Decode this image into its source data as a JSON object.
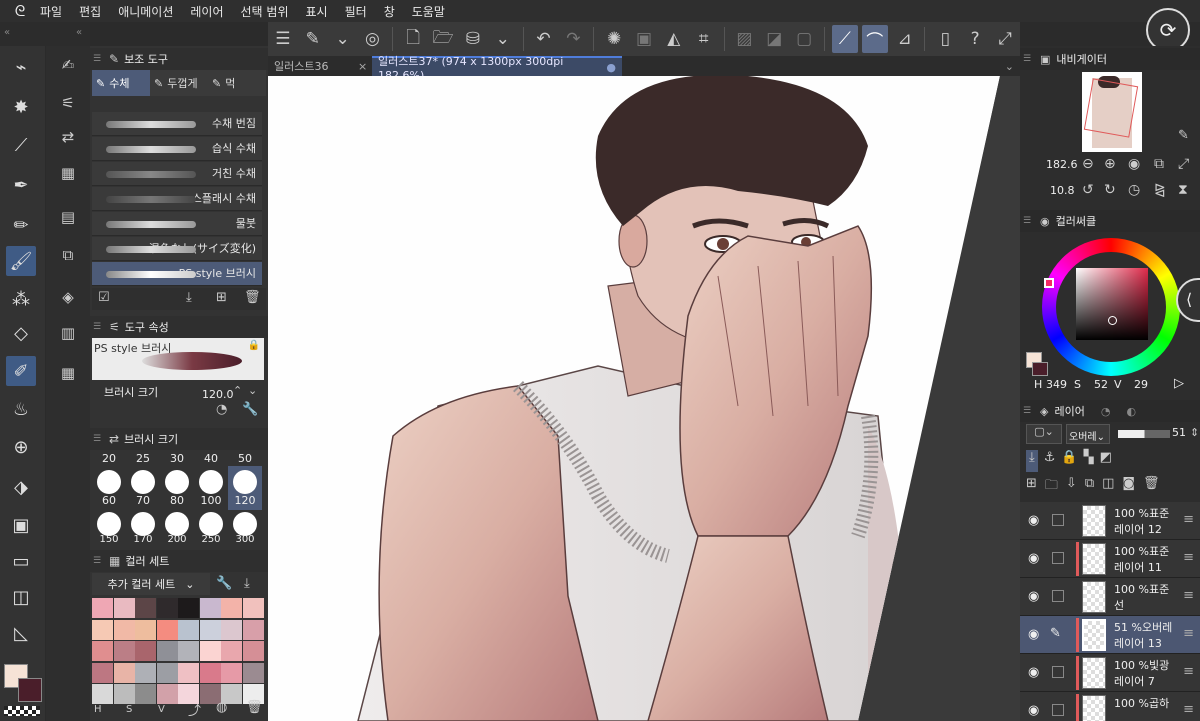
{
  "menu": {
    "items": [
      "파일",
      "편집",
      "애니메이션",
      "레이어",
      "선택 범위",
      "표시",
      "필터",
      "창",
      "도움말"
    ]
  },
  "tabs": [
    {
      "label": "일러스트36"
    },
    {
      "label": "일러스트37* (974 x 1300px 300dpi 182.6%)"
    }
  ],
  "subtool": {
    "title": "보조 도구",
    "tabs": [
      "수체",
      "두껍게",
      "먹"
    ],
    "brushes": [
      "수채 번짐",
      "습식 수채",
      "거친 수채",
      "스플래시 수채",
      "물붓",
      "混色なし(サイズ変化)",
      "PS style 브러시"
    ],
    "selected_brush": "PS style 브러시"
  },
  "tool_property": {
    "title": "도구 속성",
    "brush_name": "PS style 브러시",
    "size_label": "브러시 크기",
    "size_value": "120.0"
  },
  "brush_size": {
    "title": "브러시 크기",
    "row1": [
      "20",
      "25",
      "30",
      "40",
      "50"
    ],
    "row2": [
      "60",
      "70",
      "80",
      "100",
      "120"
    ],
    "row3": [
      "150",
      "170",
      "200",
      "250",
      "300"
    ],
    "selected": "120"
  },
  "color_set": {
    "title": "컬러 세트",
    "dropdown": "추가 컬러 세트",
    "swatches": [
      "#efa7b4",
      "#e9bac1",
      "#5c4547",
      "#2f2a2c",
      "#1d1a1b",
      "#c9b8cf",
      "#f3b3a9",
      "#f1c1bd",
      "#f6c9b4",
      "#f1b9a6",
      "#eebd9e",
      "#f48c80",
      "#b9c2cf",
      "#ccd0dc",
      "#dcc7cf",
      "#d89fa9",
      "#e08e8f",
      "#bb7e86",
      "#a9656c",
      "#8f9097",
      "#b2b3b9",
      "#fbd4d2",
      "#e9a7ad",
      "#d58f96",
      "#bd7782",
      "#e8b4a7",
      "#aeb0b6",
      "#9c9ea4",
      "#efc0c4",
      "#d97a8b",
      "#e69aa7",
      "#9b8b91",
      "#d9d9d9",
      "#bcbcbc",
      "#8c8c8c",
      "#d2a1a9",
      "#f4d6dc",
      "#8b6d73",
      "#c8c8c8",
      "#ededed"
    ],
    "footer": [
      "H",
      "S",
      "V"
    ]
  },
  "navigator": {
    "title": "내비게이터",
    "zoom": "182.6",
    "angle": "10.8"
  },
  "color_circle": {
    "title": "컬러써클",
    "h": "349",
    "s": "52",
    "v": "29",
    "h_label": "H",
    "s_label": "S",
    "v_label": "V"
  },
  "layers": {
    "title": "레이어",
    "blend": "오버레",
    "opacity": "51",
    "items": [
      {
        "opacity": "100 %표준",
        "name": "레이어 12"
      },
      {
        "opacity": "100 %표준",
        "name": "레이어 11"
      },
      {
        "opacity": "100 %표준",
        "name": "선"
      },
      {
        "opacity": "51 %오버레",
        "name": "레이어 13"
      },
      {
        "opacity": "100 %빛광",
        "name": "레이어 7"
      },
      {
        "opacity": "100 %곱하",
        "name": ""
      }
    ]
  },
  "colors": {
    "main": "#f6e3d6",
    "sub": "#4a1e2a",
    "accent": "#4f7ddb"
  }
}
